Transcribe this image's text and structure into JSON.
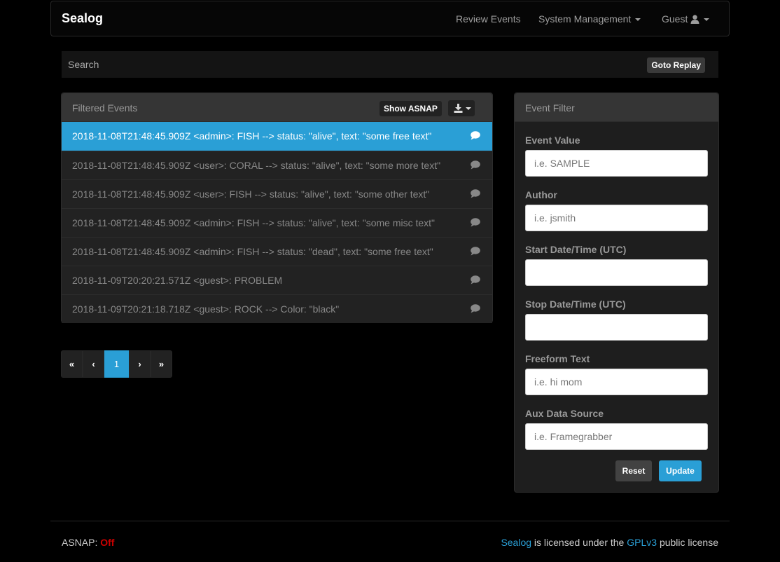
{
  "navbar": {
    "brand": "Sealog",
    "review_events": "Review Events",
    "system_management": "System Management",
    "user": "Guest"
  },
  "search": {
    "label": "Search",
    "goto_replay": "Goto Replay"
  },
  "events_panel": {
    "title": "Filtered Events",
    "show_asnap": "Show ASNAP",
    "rows": [
      {
        "text": "2018-11-08T21:48:45.909Z <admin>: FISH --> status: \"alive\", text: \"some free text\""
      },
      {
        "text": "2018-11-08T21:48:45.909Z <user>: CORAL --> status: \"alive\", text: \"some more text\""
      },
      {
        "text": "2018-11-08T21:48:45.909Z <user>: FISH --> status: \"alive\", text: \"some other text\""
      },
      {
        "text": "2018-11-08T21:48:45.909Z <admin>: FISH --> status: \"alive\", text: \"some misc text\""
      },
      {
        "text": "2018-11-08T21:48:45.909Z <admin>: FISH --> status: \"dead\", text: \"some free text\""
      },
      {
        "text": "2018-11-09T20:20:21.571Z <guest>: PROBLEM"
      },
      {
        "text": "2018-11-09T20:21:18.718Z <guest>: ROCK --> Color: \"black\""
      }
    ]
  },
  "pagination": {
    "first": "«",
    "prev": "‹",
    "current": "1",
    "next": "›",
    "last": "»"
  },
  "filter_panel": {
    "title": "Event Filter",
    "fields": [
      {
        "label": "Event Value",
        "placeholder": "i.e. SAMPLE",
        "value": ""
      },
      {
        "label": "Author",
        "placeholder": "i.e. jsmith",
        "value": ""
      },
      {
        "label": "Start Date/Time (UTC)",
        "placeholder": "",
        "value": ""
      },
      {
        "label": "Stop Date/Time (UTC)",
        "placeholder": "",
        "value": ""
      },
      {
        "label": "Freeform Text",
        "placeholder": "i.e. hi mom",
        "value": ""
      },
      {
        "label": "Aux Data Source",
        "placeholder": "i.e. Framegrabber",
        "value": ""
      }
    ],
    "reset": "Reset",
    "update": "Update"
  },
  "footer": {
    "asnap_label": "ASNAP:",
    "asnap_status": "Off",
    "app_name": "Sealog",
    "license_pre": "is licensed under the",
    "license_name": "GPLv3",
    "license_post": "public license"
  },
  "colors": {
    "accent": "#2a9fd6",
    "asnap_off": "#cc0000",
    "background": "#000000"
  }
}
